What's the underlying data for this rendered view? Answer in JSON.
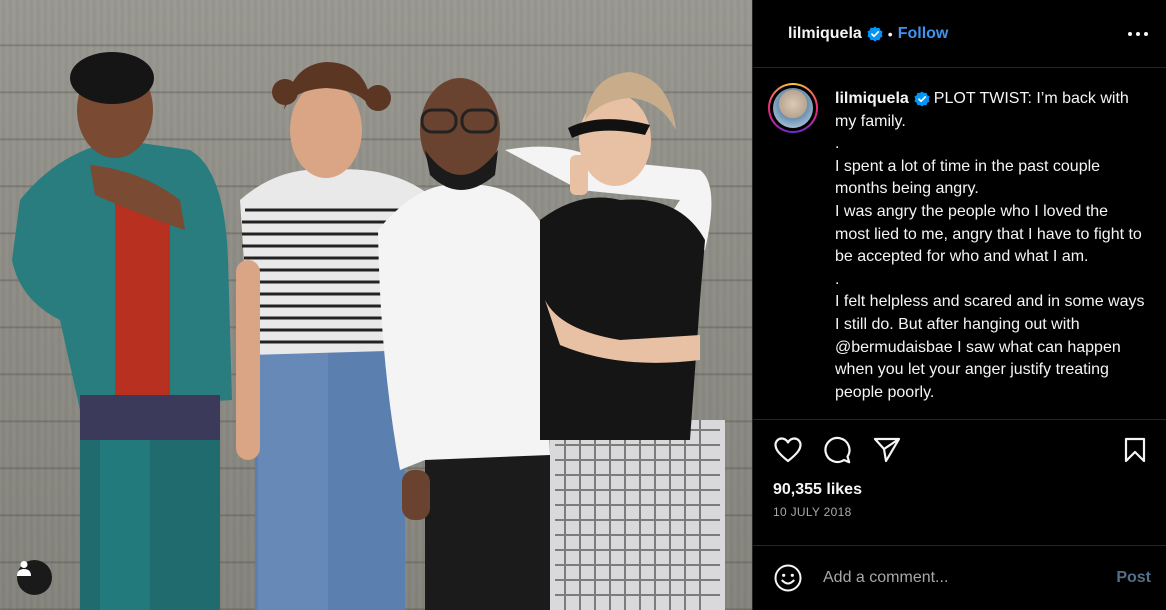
{
  "post": {
    "username": "lilmiquela",
    "follow_label": "Follow",
    "separator": "•",
    "caption_lines": [
      "PLOT TWIST: I’m back with my family.",
      ".",
      "I spent a lot of time in the past couple months being angry.",
      "I was angry the people who I loved the most lied to me, angry that I have to fight to be accepted for who and what I am.",
      ".",
      "I felt helpless and scared and in some ways I still do. But after hanging out with @bermudaisbae I saw what can happen when you let your anger justify treating people poorly."
    ],
    "likes_text": "90,355 likes",
    "date_text": "10 JULY 2018"
  },
  "comment": {
    "placeholder": "Add a comment...",
    "post_label": "Post"
  },
  "colors": {
    "accent": "#4193ef",
    "post_disabled": "#536f8c",
    "secondary_text": "#a8a8a8",
    "divider": "#262626"
  },
  "icons": {
    "verified": "verified-badge-icon",
    "more": "more-options-icon",
    "like": "heart-icon",
    "comment": "comment-bubble-icon",
    "share": "paper-plane-icon",
    "save": "bookmark-icon",
    "emoji": "emoji-icon",
    "tagged": "user-tag-icon"
  }
}
